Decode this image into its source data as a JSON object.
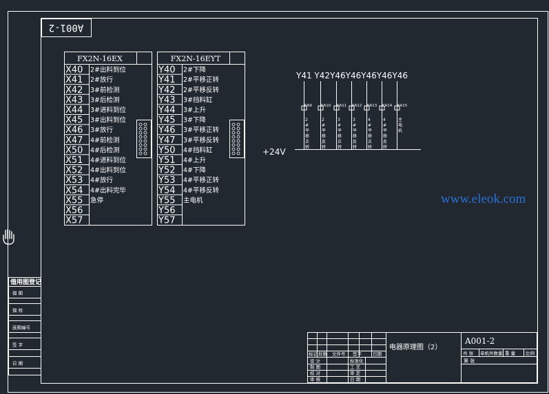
{
  "drawing": {
    "rotated_code": "A001-2",
    "plc1": {
      "model": "FX2N-16EX",
      "rows": [
        {
          "addr": "X40",
          "desc": "2#出料到位"
        },
        {
          "addr": "X41",
          "desc": "2#放行"
        },
        {
          "addr": "X42",
          "desc": "3#前检测"
        },
        {
          "addr": "X43",
          "desc": "3#后检测"
        },
        {
          "addr": "X44",
          "desc": "3#进料到位"
        },
        {
          "addr": "X45",
          "desc": "3#出料到位"
        },
        {
          "addr": "X46",
          "desc": "3#放行"
        },
        {
          "addr": "X47",
          "desc": "4#前检测"
        },
        {
          "addr": "X50",
          "desc": "4#后检测"
        },
        {
          "addr": "X51",
          "desc": "4#进料到位"
        },
        {
          "addr": "X52",
          "desc": "4#出料到位"
        },
        {
          "addr": "X53",
          "desc": "4#放行"
        },
        {
          "addr": "X54",
          "desc": "4#出料完毕"
        },
        {
          "addr": "X55",
          "desc": "急停"
        },
        {
          "addr": "X56",
          "desc": ""
        },
        {
          "addr": "X57",
          "desc": ""
        }
      ]
    },
    "plc2": {
      "model": "FX2N-16EYT",
      "rows": [
        {
          "addr": "Y40",
          "desc": "2#下降"
        },
        {
          "addr": "Y41",
          "desc": "2#平移正转"
        },
        {
          "addr": "Y42",
          "desc": "2#平移反转"
        },
        {
          "addr": "Y43",
          "desc": "3#挡料缸"
        },
        {
          "addr": "Y44",
          "desc": "3#上升"
        },
        {
          "addr": "Y45",
          "desc": "3#下降"
        },
        {
          "addr": "Y46",
          "desc": "3#平移正转"
        },
        {
          "addr": "Y47",
          "desc": "3#平移反转"
        },
        {
          "addr": "Y50",
          "desc": "4#挡料缸"
        },
        {
          "addr": "Y51",
          "desc": "4#上升"
        },
        {
          "addr": "Y52",
          "desc": "4#下降"
        },
        {
          "addr": "Y53",
          "desc": "4#平移正转"
        },
        {
          "addr": "Y54",
          "desc": "4#平移反转"
        },
        {
          "addr": "Y55",
          "desc": "主电机"
        },
        {
          "addr": "Y56",
          "desc": ""
        },
        {
          "addr": "Y57",
          "desc": ""
        }
      ]
    },
    "relays": {
      "header_text": "Y41 Y42Y46Y46Y46Y46Y46",
      "items": [
        {
          "tag": "KA9",
          "desc": "2#平移正转"
        },
        {
          "tag": "KA10",
          "desc": "2#平移反转"
        },
        {
          "tag": "KA11",
          "desc": "3#平移正转"
        },
        {
          "tag": "KA12",
          "desc": "3#平移反转"
        },
        {
          "tag": "KA13",
          "desc": "4#平移正转"
        },
        {
          "tag": "KA14",
          "desc": "4#平移反转"
        },
        {
          "tag": "KA15",
          "desc": "主电机"
        }
      ],
      "supply": "+24V"
    },
    "watermark": "www.eleok.com",
    "left_strip": {
      "header": "借用图登记",
      "labels": [
        "描 图",
        "描 校",
        "底图编号",
        "签 字",
        "日 期"
      ]
    },
    "title_block": {
      "title": "电器原理图（2）",
      "code": "A001-2",
      "rev_headers": [
        "标记",
        "处数",
        "文件号",
        "签字",
        "日期"
      ],
      "approvals": [
        {
          "role": "设 计",
          "role2": "标准化"
        },
        {
          "role": "制 图",
          "role2": "工 艺"
        },
        {
          "role": "校 对",
          "role2": "审 定"
        },
        {
          "role": "审 核",
          "role2": "日 期"
        }
      ],
      "right_headers": [
        "共 张",
        "单机件数量",
        "重 量",
        "比例"
      ],
      "sheet_label": "第 张"
    }
  },
  "colors": {
    "background": "#212830",
    "line": "#ffffff",
    "watermark": "#2b6fd6"
  }
}
